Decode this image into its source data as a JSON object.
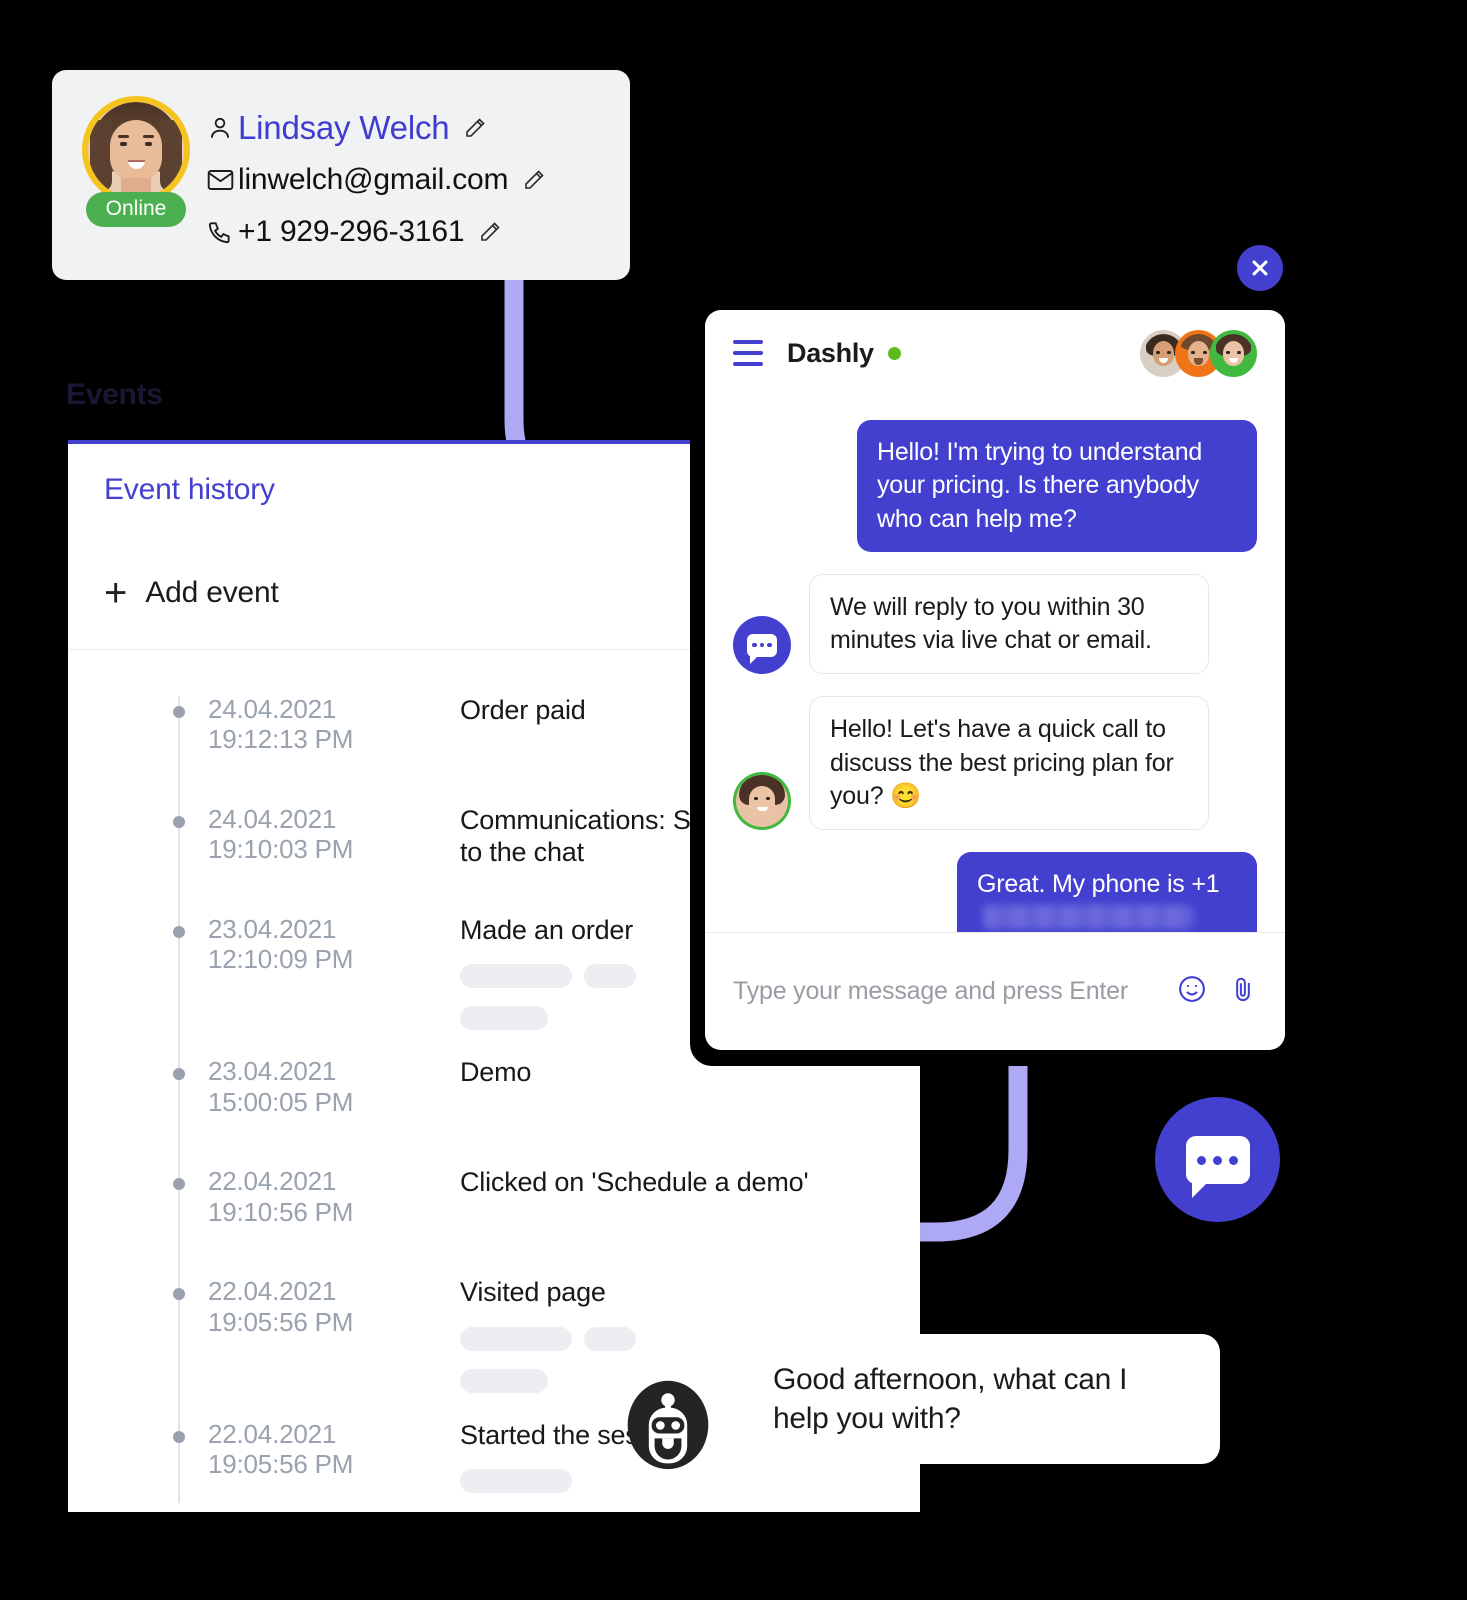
{
  "contact": {
    "name": "Lindsay Welch",
    "email": "linwelch@gmail.com",
    "phone": "+1 929-296-3161",
    "status_badge": "Online",
    "name_color": "#3F3CD1",
    "badge_color": "#4CAF50",
    "avatar_ring_color": "#F5C41E",
    "icons": {
      "user": "user-icon",
      "email": "envelope-icon",
      "phone": "phone-icon",
      "edit": "pencil-icon"
    }
  },
  "events_panel": {
    "section_title": "Events",
    "tab_label": "Event history",
    "add_event_label": "Add event",
    "add_event_icon": "plus-icon",
    "accent_color": "#4340D0",
    "events": [
      {
        "date": "24.04.2021",
        "time": "19:12:13 PM",
        "title": "Order paid",
        "skeletons": []
      },
      {
        "date": "24.04.2021",
        "time": "19:10:03 PM",
        "title": "Communications: Sent a message to the chat",
        "skeletons": []
      },
      {
        "date": "23.04.2021",
        "time": "12:10:09 PM",
        "title": "Made an order",
        "skeletons": [
          [
            112,
            52
          ],
          [
            88
          ]
        ]
      },
      {
        "date": "23.04.2021",
        "time": "15:00:05 PM",
        "title": "Demo",
        "skeletons": []
      },
      {
        "date": "22.04.2021",
        "time": "19:10:56 PM",
        "title": "Clicked on 'Schedule a demo'",
        "skeletons": []
      },
      {
        "date": "22.04.2021",
        "time": "19:05:56 PM",
        "title": "Visited page",
        "skeletons": [
          [
            112,
            52
          ],
          [
            88
          ]
        ]
      },
      {
        "date": "22.04.2021",
        "time": "19:05:56 PM",
        "title": "Started the session",
        "skeletons": [
          [
            112
          ]
        ]
      }
    ]
  },
  "chat": {
    "title": "Dashly",
    "online_dot_color": "#5DBB1E",
    "menu_icon": "hamburger-menu-icon",
    "messages": [
      {
        "side": "out",
        "text": "Hello! I'm trying to understand your pricing. Is there anybody who can help me?",
        "avatar": "none"
      },
      {
        "side": "in",
        "text": "We will reply to you within 30 minutes via live chat or email.",
        "avatar": "bot"
      },
      {
        "side": "in",
        "text": "Hello! Let's have a quick call to discuss the best pricing plan for you? 😊",
        "avatar": "operator"
      },
      {
        "side": "out",
        "text": "Great. My phone is +1",
        "avatar": "none",
        "redacted": true
      }
    ],
    "input_placeholder": "Type your message and press Enter",
    "emoji_icon": "smiley-icon",
    "attach_icon": "paperclip-icon",
    "close_icon": "close-x-icon",
    "bubble_color": "#4340D0"
  },
  "launcher": {
    "icon": "chat-bubble-icon",
    "color": "#4340D0"
  },
  "bot_prompt": {
    "icon": "robot-icon",
    "text": "Good afternoon, what can I help you with?"
  }
}
